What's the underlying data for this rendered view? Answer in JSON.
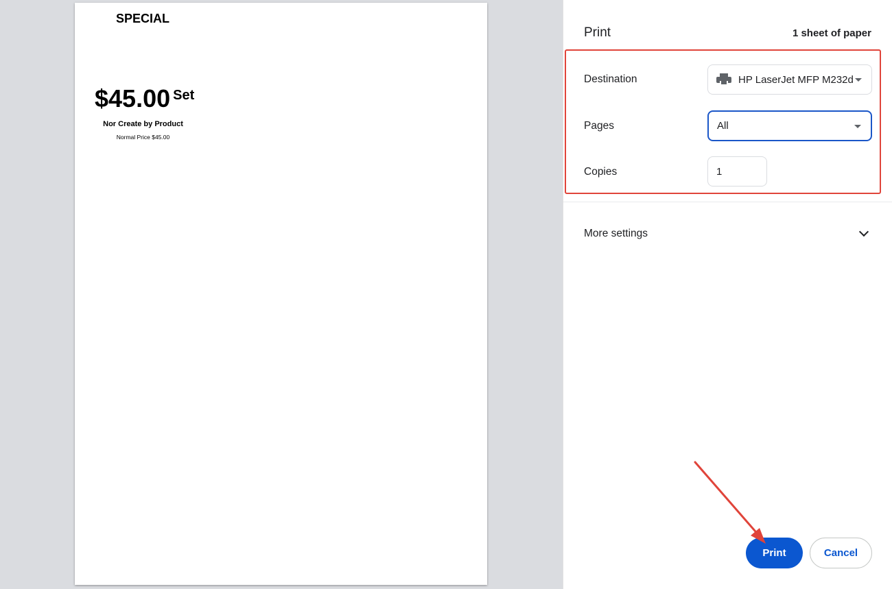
{
  "preview": {
    "special_label": "SPECIAL",
    "price": "$45.00",
    "unit": "Set",
    "product_name": "Nor Create by Product",
    "normal_price": "Normal Price $45.00"
  },
  "settings": {
    "title": "Print",
    "sheet_count": "1 sheet of paper",
    "destination_label": "Destination",
    "destination_value": "HP LaserJet MFP M232d",
    "pages_label": "Pages",
    "pages_value": "All",
    "copies_label": "Copies",
    "copies_value": "1",
    "more_settings_label": "More settings"
  },
  "buttons": {
    "print_label": "Print",
    "cancel_label": "Cancel"
  },
  "colors": {
    "primary": "#0b57d0",
    "highlight": "#e0443a",
    "preview_bg": "#dadce0"
  },
  "icons": {
    "printer": "printer-icon",
    "dropdown": "caret-down-icon",
    "expand": "chevron-down-icon"
  }
}
